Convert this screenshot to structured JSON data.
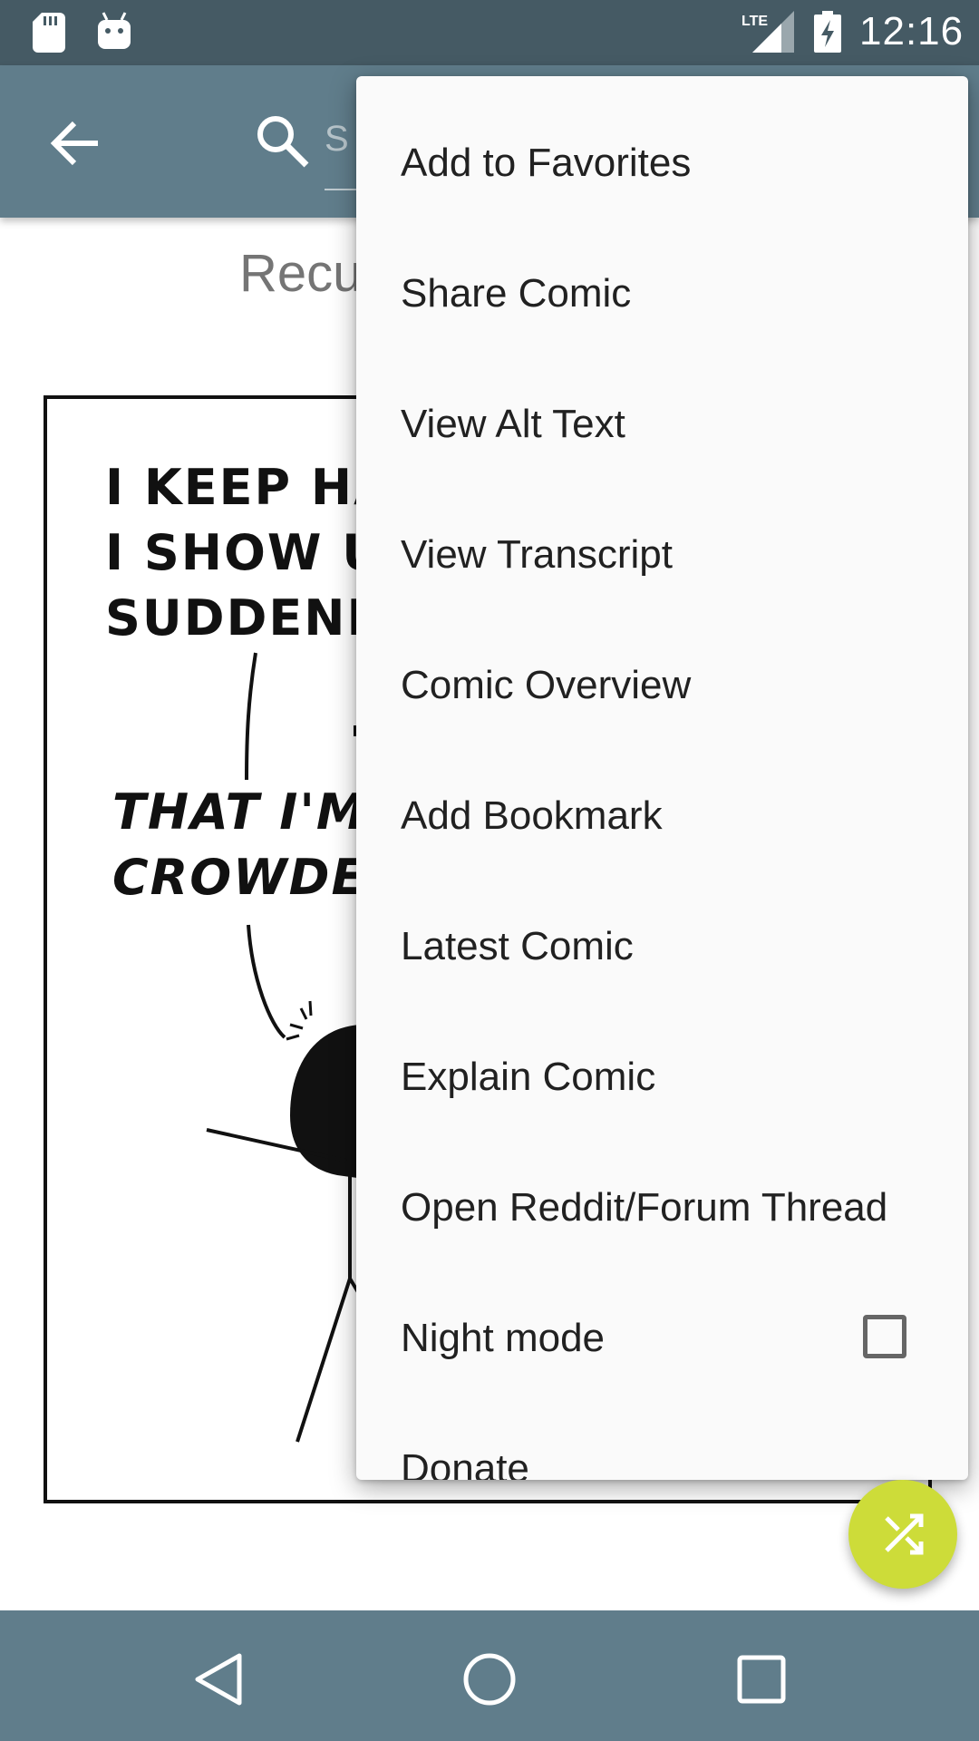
{
  "status_bar": {
    "time": "12:16",
    "network": "LTE",
    "icons": [
      "sd-card-icon",
      "android-icon",
      "lte-signal-icon",
      "battery-charging-icon"
    ]
  },
  "toolbar": {
    "back_icon": "arrow-back-icon",
    "search_icon": "search-icon",
    "search_placeholder": "S"
  },
  "comic": {
    "title": "Recu",
    "text_top": [
      "I KEEP HAV",
      "I SHOW UP",
      "SUDDENLY F"
    ],
    "text_bottom": [
      "THAT I'M I",
      "CROWDED F"
    ]
  },
  "menu": {
    "items": [
      {
        "label": "Add to Favorites"
      },
      {
        "label": "Share Comic"
      },
      {
        "label": "View Alt Text"
      },
      {
        "label": "View Transcript"
      },
      {
        "label": "Comic Overview"
      },
      {
        "label": "Add Bookmark"
      },
      {
        "label": "Latest Comic"
      },
      {
        "label": "Explain Comic"
      },
      {
        "label": "Open Reddit/Forum Thread"
      },
      {
        "label": "Night mode",
        "checked": false
      },
      {
        "label": "Donate"
      }
    ]
  },
  "fab": {
    "icon": "shuffle-icon",
    "color": "#cddc39"
  },
  "nav_bar": {
    "icons": [
      "nav-back-icon",
      "nav-home-icon",
      "nav-recents-icon"
    ]
  },
  "colors": {
    "status_bar": "#455a64",
    "toolbar": "#607d8b",
    "nav_bar": "#607d8b",
    "menu_bg": "#fafafa",
    "accent": "#cddc39"
  }
}
